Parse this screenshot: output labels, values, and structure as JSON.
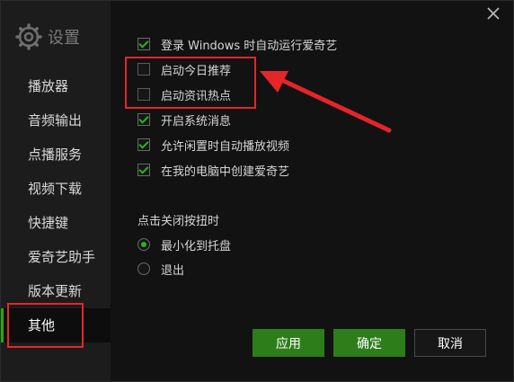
{
  "window": {
    "close_icon": "close-icon"
  },
  "sidebar": {
    "title": "设置",
    "items": [
      {
        "label": "播放器",
        "active": false
      },
      {
        "label": "音频输出",
        "active": false
      },
      {
        "label": "点播服务",
        "active": false
      },
      {
        "label": "视频下载",
        "active": false
      },
      {
        "label": "快捷键",
        "active": false
      },
      {
        "label": "爱奇艺助手",
        "active": false
      },
      {
        "label": "版本更新",
        "active": false
      },
      {
        "label": "其他",
        "active": true
      }
    ]
  },
  "options": [
    {
      "label": "登录 Windows 时自动运行爱奇艺",
      "checked": true
    },
    {
      "label": "启动今日推荐",
      "checked": false
    },
    {
      "label": "启动资讯热点",
      "checked": false
    },
    {
      "label": "开启系统消息",
      "checked": true
    },
    {
      "label": "允许闲置时自动播放视频",
      "checked": true
    },
    {
      "label": "在我的电脑中创建爱奇艺",
      "checked": true
    }
  ],
  "close_action": {
    "label": "点击关闭按扭时",
    "options": [
      {
        "label": "最小化到托盘",
        "selected": true
      },
      {
        "label": "退出",
        "selected": false
      }
    ]
  },
  "buttons": {
    "apply": "应用",
    "ok": "确定",
    "cancel": "取消"
  },
  "colors": {
    "accent": "#2aa515",
    "annotation": "#e5252a"
  }
}
